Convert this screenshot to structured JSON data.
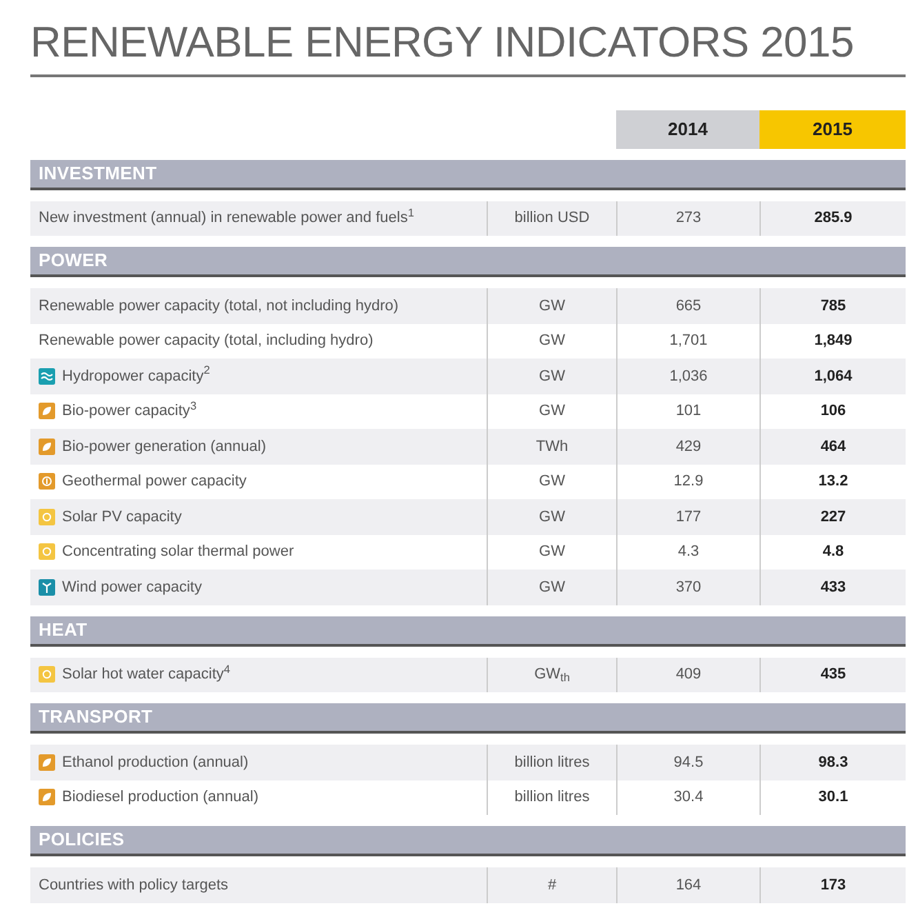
{
  "title": "RENEWABLE ENERGY INDICATORS 2015",
  "columns": [
    {
      "label": "2014",
      "highlighted": false
    },
    {
      "label": "2015",
      "highlighted": true
    }
  ],
  "sections": [
    {
      "heading": "INVESTMENT",
      "rows": [
        {
          "label": "New investment (annual) in renewable power and fuels$^{1}$",
          "unit": "billion USD",
          "values": [
            "273",
            "285.9"
          ]
        }
      ]
    },
    {
      "heading": "POWER",
      "rows": [
        {
          "label": "Renewable power capacity (total, not including hydro)",
          "unit": "GW",
          "values": [
            "665",
            "785"
          ]
        },
        {
          "label": "Renewable power capacity (total, including hydro)",
          "unit": "GW",
          "values": [
            "1,701",
            "1,849"
          ]
        },
        {
          "label": "Hydropower capacity$^{2}$",
          "unit": "GW",
          "values": [
            "1,036",
            "1,064"
          ],
          "kind": "hydro"
        },
        {
          "label": "Bio-power capacity$^{3}$",
          "unit": "GW",
          "values": [
            "101",
            "106"
          ],
          "kind": "bio"
        },
        {
          "label": "Bio-power generation (annual)",
          "unit": "TWh",
          "values": [
            "429",
            "464"
          ],
          "kind": "bio"
        },
        {
          "label": "Geothermal power capacity",
          "unit": "GW",
          "values": [
            "12.9",
            "13.2"
          ],
          "kind": "geothermal"
        },
        {
          "label": "Solar PV capacity",
          "unit": "GW",
          "values": [
            "177",
            "227"
          ],
          "kind": "solar"
        },
        {
          "label": "Concentrating solar thermal power",
          "unit": "GW",
          "values": [
            "4.3",
            "4.8"
          ],
          "kind": "solar"
        },
        {
          "label": "Wind power capacity",
          "unit": "GW",
          "values": [
            "370",
            "433"
          ],
          "kind": "wind"
        }
      ]
    },
    {
      "heading": "HEAT",
      "rows": [
        {
          "label": "Solar hot water capacity$^{4}$",
          "unit": "GW$_{th}$",
          "values": [
            "409",
            "435"
          ],
          "kind": "solar"
        }
      ]
    },
    {
      "heading": "TRANSPORT",
      "rows": [
        {
          "label": "Ethanol production (annual)",
          "unit": "billion litres",
          "values": [
            "94.5",
            "98.3"
          ],
          "kind": "bio"
        },
        {
          "label": "Biodiesel production (annual)",
          "unit": "billion litres",
          "values": [
            "30.4",
            "30.1"
          ],
          "kind": "bio"
        }
      ]
    },
    {
      "heading": "POLICIES",
      "rows": [
        {
          "label": "Countries with policy targets",
          "unit": "#",
          "values": [
            "164",
            "173"
          ]
        }
      ]
    }
  ]
}
